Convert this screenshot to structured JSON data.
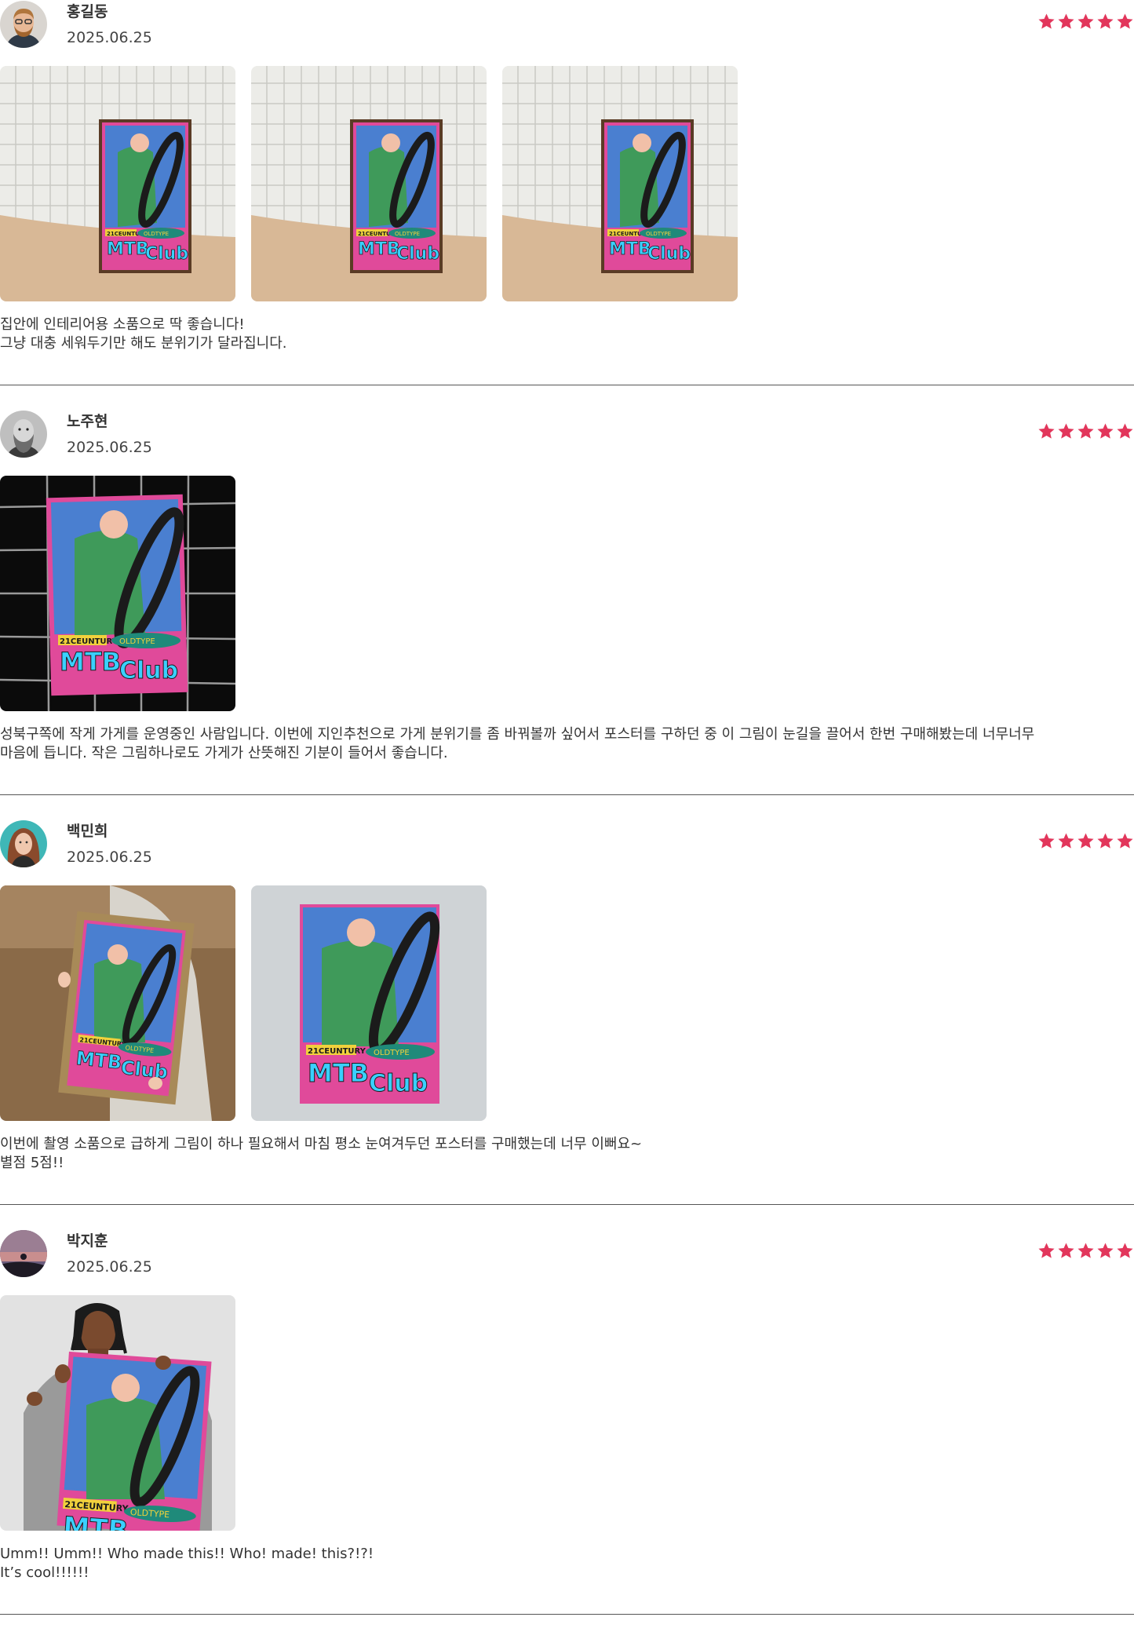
{
  "colors": {
    "star": "#e2365b",
    "divider": "#555555",
    "text": "#333333"
  },
  "reviews": [
    {
      "name": "홍길동",
      "date": "2025.06.25",
      "rating": 5,
      "text": "집안에 인테리어용 소품으로 딱 좋습니다!\n그냥 대충 세워두기만 해도 분위기가 달라집니다.",
      "photos": [
        "poster-on-tiled-wall-photo",
        "poster-on-tiled-wall-photo",
        "poster-on-tiled-wall-photo"
      ]
    },
    {
      "name": "노주현",
      "date": "2025.06.25",
      "rating": 5,
      "text": "성북구쪽에 작게 가게를 운영중인 사람입니다. 이번에 지인추천으로 가게 분위기를 좀 바꿔볼까 싶어서 포스터를 구하던 중 이 그림이 눈길을 끌어서 한번 구매해봤는데 너무너무 마음에 듭니다. 작은 그림하나로도 가게가 산뜻해진 기분이 들어서 좋습니다.",
      "photos": [
        "poster-on-black-grid-photo"
      ]
    },
    {
      "name": "백민희",
      "date": "2025.06.25",
      "rating": 5,
      "text": "이번에 촬영 소품으로 급하게 그림이 하나 필요해서 마침 평소 눈여겨두던 포스터를 구매했는데 너무 이뻐요~\n별점 5점!!",
      "photos": [
        "person-holding-framed-poster-photo",
        "poster-on-gray-background-photo"
      ]
    },
    {
      "name": "박지훈",
      "date": "2025.06.25",
      "rating": 5,
      "text": "Umm!! Umm!! Who made this!! Who! made! this?!?!\nIt’s cool!!!!!!",
      "photos": [
        "man-holding-poster-photo"
      ]
    }
  ],
  "poster": {
    "line1": "21CEUNTURY",
    "line2": "OLDTYPE",
    "line3": "MTB",
    "line4": "Club"
  }
}
